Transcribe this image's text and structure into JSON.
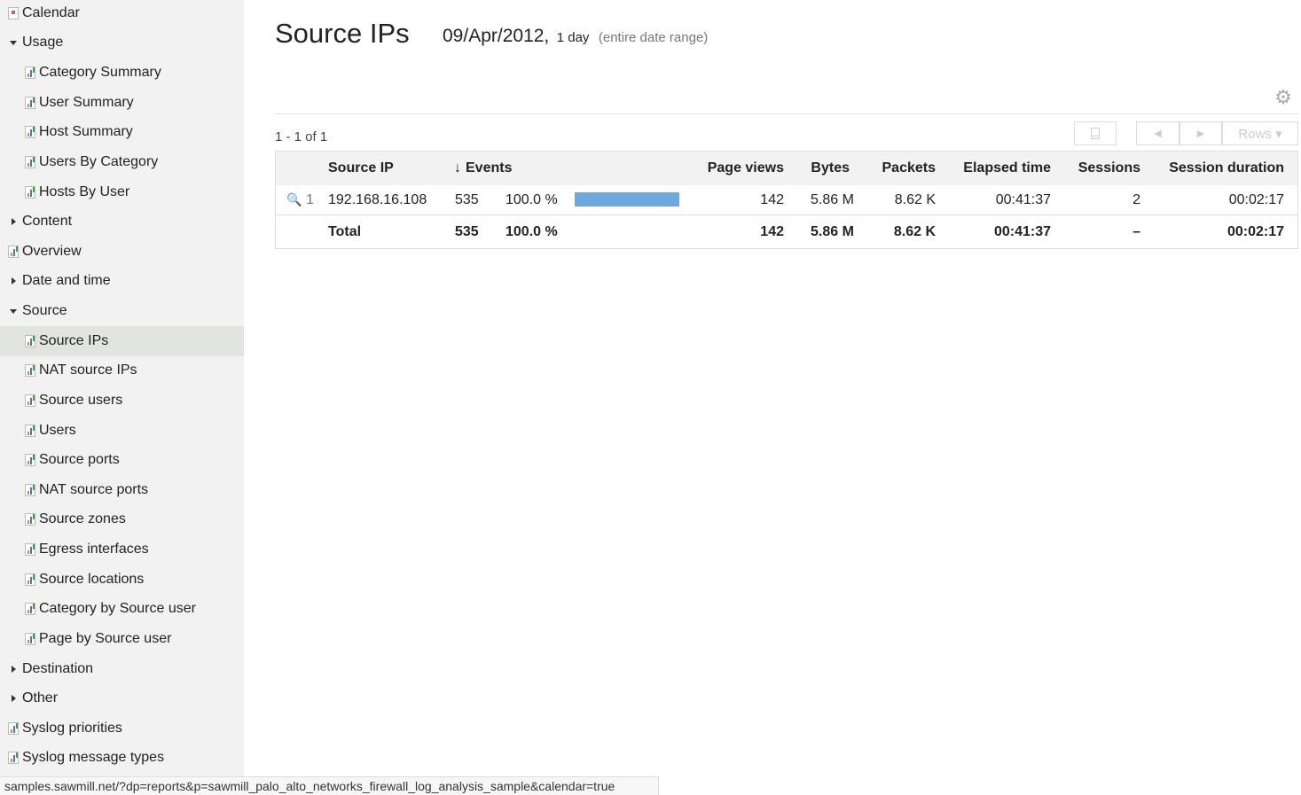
{
  "sidebar": {
    "items": [
      {
        "label": "Calendar",
        "icon": "calendar-icon"
      },
      {
        "label": "Usage",
        "icon": "expanded-triangle-icon"
      },
      {
        "label": "Category Summary",
        "icon": "report-icon"
      },
      {
        "label": "User Summary",
        "icon": "report-icon"
      },
      {
        "label": "Host Summary",
        "icon": "report-icon"
      },
      {
        "label": "Users By Category",
        "icon": "report-icon"
      },
      {
        "label": "Hosts By User",
        "icon": "report-icon"
      },
      {
        "label": "Content",
        "icon": "collapsed-triangle-icon"
      },
      {
        "label": "Overview",
        "icon": "report-icon"
      },
      {
        "label": "Date and time",
        "icon": "collapsed-triangle-icon"
      },
      {
        "label": "Source",
        "icon": "expanded-triangle-icon"
      },
      {
        "label": "Source IPs",
        "icon": "report-icon",
        "active": true
      },
      {
        "label": "NAT source IPs",
        "icon": "report-icon"
      },
      {
        "label": "Source users",
        "icon": "report-icon"
      },
      {
        "label": "Users",
        "icon": "report-icon"
      },
      {
        "label": "Source ports",
        "icon": "report-icon"
      },
      {
        "label": "NAT source ports",
        "icon": "report-icon"
      },
      {
        "label": "Source zones",
        "icon": "report-icon"
      },
      {
        "label": "Egress interfaces",
        "icon": "report-icon"
      },
      {
        "label": "Source locations",
        "icon": "report-icon"
      },
      {
        "label": "Category by Source user",
        "icon": "report-icon"
      },
      {
        "label": "Page by Source user",
        "icon": "report-icon"
      },
      {
        "label": "Destination",
        "icon": "collapsed-triangle-icon"
      },
      {
        "label": "Other",
        "icon": "collapsed-triangle-icon"
      },
      {
        "label": "Syslog priorities",
        "icon": "report-icon"
      },
      {
        "label": "Syslog message types",
        "icon": "report-icon"
      }
    ]
  },
  "header": {
    "title": "Source IPs",
    "date": "09/Apr/2012,",
    "length": "1 day",
    "range_note": "(entire date range)",
    "gear_icon": "gear-icon"
  },
  "toolbar": {
    "pager": "1 - 1 of 1",
    "prev_symbol": "◀",
    "next_symbol": "▶",
    "rows_label": "Rows ▾"
  },
  "table": {
    "sort_arrow": "↓",
    "columns": {
      "source_ip": "Source IP",
      "events": "Events",
      "page_views": "Page views",
      "bytes": "Bytes",
      "packets": "Packets",
      "elapsed_time": "Elapsed time",
      "sessions": "Sessions",
      "session_duration": "Session duration"
    },
    "rows": [
      {
        "rank": "1",
        "source_ip": "192.168.16.108",
        "events": "535",
        "events_pct": "100.0 %",
        "bar_fraction": 1.0,
        "page_views": "142",
        "bytes": "5.86 M",
        "packets": "8.62 K",
        "elapsed_time": "00:41:37",
        "sessions": "2",
        "session_duration": "00:02:17"
      }
    ],
    "total": {
      "label": "Total",
      "events": "535",
      "events_pct": "100.0 %",
      "page_views": "142",
      "bytes": "5.86 M",
      "packets": "8.62 K",
      "elapsed_time": "00:41:37",
      "sessions": "–",
      "session_duration": "00:02:17"
    }
  },
  "statusbar": {
    "url": "samples.sawmill.net/?dp=reports&p=sawmill_palo_alto_networks_firewall_log_analysis_sample&calendar=true"
  },
  "colors": {
    "bar": "#6fa8dc",
    "sidebar_bg": "#f2f2f2",
    "active_item_bg": "#e2e4e0"
  }
}
